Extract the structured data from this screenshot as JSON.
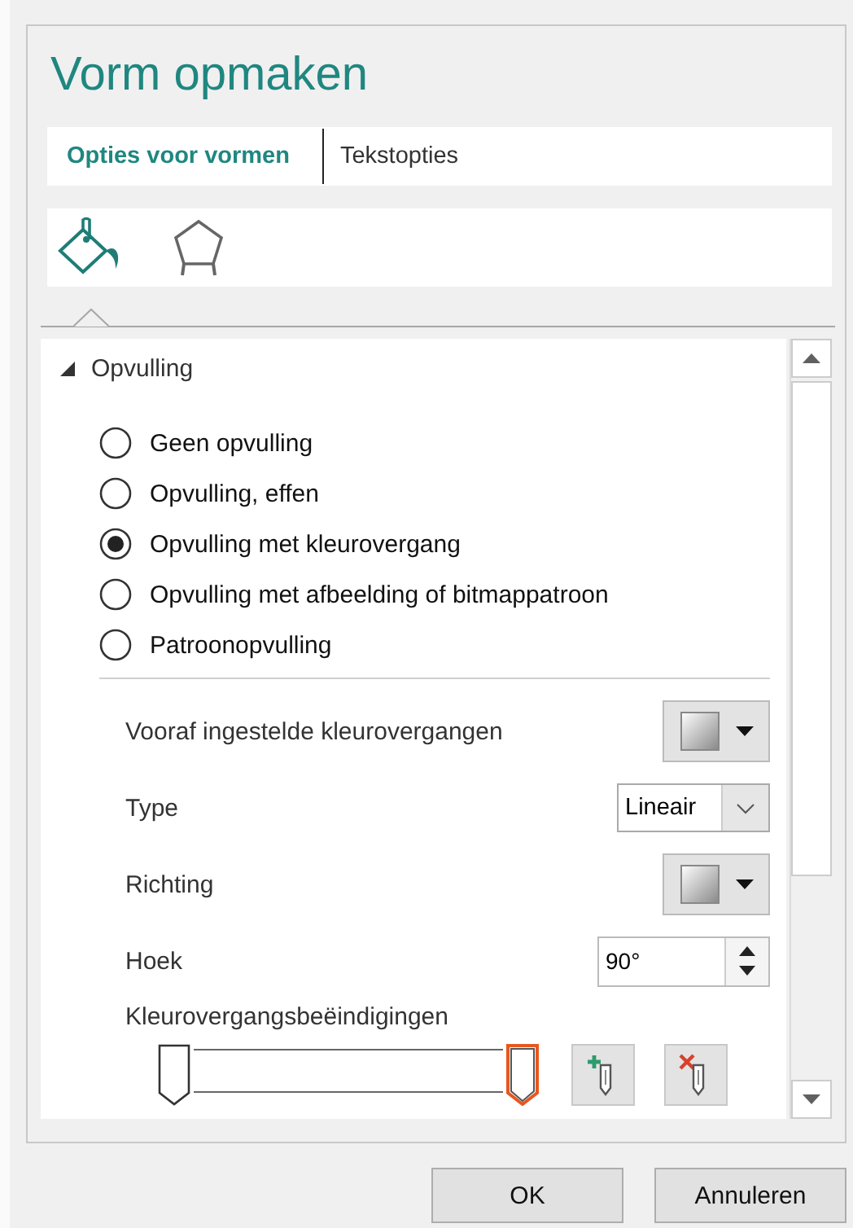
{
  "title": "Vorm opmaken",
  "tabs": [
    {
      "label": "Opties voor vormen",
      "selected": true
    },
    {
      "label": "Tekstopties",
      "selected": false
    }
  ],
  "category_icons": [
    {
      "kind": "fill",
      "selected": true
    },
    {
      "kind": "shape",
      "selected": false
    }
  ],
  "section": {
    "title": "Opvulling",
    "expanded": true
  },
  "fill_options": [
    {
      "label": "Geen opvulling",
      "selected": false
    },
    {
      "label": "Opvulling, effen",
      "selected": false
    },
    {
      "label": "Opvulling met kleurovergang",
      "selected": true
    },
    {
      "label": "Opvulling met afbeelding of bitmappatroon",
      "selected": false
    },
    {
      "label": "Patroonopvulling",
      "selected": false
    }
  ],
  "settings": [
    {
      "kind": "gradient_picker",
      "label": "Vooraf ingestelde kleurovergangen"
    },
    {
      "kind": "select",
      "label": "Type",
      "value": "Lineair"
    },
    {
      "kind": "gradient_picker",
      "label": "Richting"
    },
    {
      "kind": "spinner",
      "label": "Hoek",
      "value": "90°"
    }
  ],
  "gradient_stops": {
    "label": "Kleurovergangsbeëindigingen",
    "stops": [
      {
        "selected": false
      },
      {
        "selected": true
      }
    ]
  },
  "buttons": [
    {
      "label": "OK"
    },
    {
      "label": "Annuleren"
    }
  ]
}
